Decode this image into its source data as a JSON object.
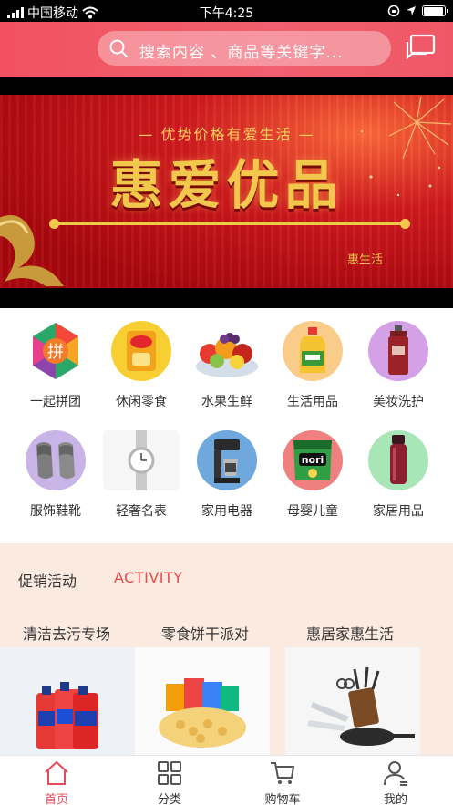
{
  "status_bar": {
    "carrier": "中国移动",
    "time": "下午4:25"
  },
  "header": {
    "search_placeholder": "搜索内容 、商品等关键字..."
  },
  "banner": {
    "subtitle": "优势价格有爱生活",
    "brand": "惠爱优品",
    "tag": "惠生活"
  },
  "categories": [
    {
      "label": "一起拼团",
      "icon": "group-buy-icon",
      "glyph": "拼"
    },
    {
      "label": "休闲零食",
      "icon": "snack-chips-icon"
    },
    {
      "label": "水果生鲜",
      "icon": "fruit-basket-icon"
    },
    {
      "label": "生活用品",
      "icon": "cooking-oil-icon"
    },
    {
      "label": "美妆洗护",
      "icon": "cosmetics-bottle-icon"
    },
    {
      "label": "服饰鞋靴",
      "icon": "slippers-icon"
    },
    {
      "label": "轻奢名表",
      "icon": "wristwatch-icon"
    },
    {
      "label": "家用电器",
      "icon": "coffee-maker-icon"
    },
    {
      "label": "母婴儿童",
      "icon": "seaweed-snack-icon",
      "glyph": "nori"
    },
    {
      "label": "家居用品",
      "icon": "thermos-icon"
    }
  ],
  "promo": {
    "title": "促销活动",
    "title_en": "ACTIVITY",
    "items": [
      {
        "label": "清洁去污专场",
        "image": "detergent-bottles-icon"
      },
      {
        "label": "零食饼干派对",
        "image": "snack-pile-icon"
      },
      {
        "label": "惠居家惠生活",
        "image": "knife-set-icon"
      }
    ]
  },
  "nav": [
    {
      "label": "首页",
      "icon": "home-icon",
      "active": true
    },
    {
      "label": "分类",
      "icon": "grid-icon",
      "active": false
    },
    {
      "label": "购物车",
      "icon": "cart-icon",
      "active": false
    },
    {
      "label": "我的",
      "icon": "user-icon",
      "active": false
    }
  ],
  "colors": {
    "accent": "#e84a5a",
    "header": "#f05665",
    "banner_gold": "#f1c84b",
    "promo_bg": "#fbeadf"
  }
}
